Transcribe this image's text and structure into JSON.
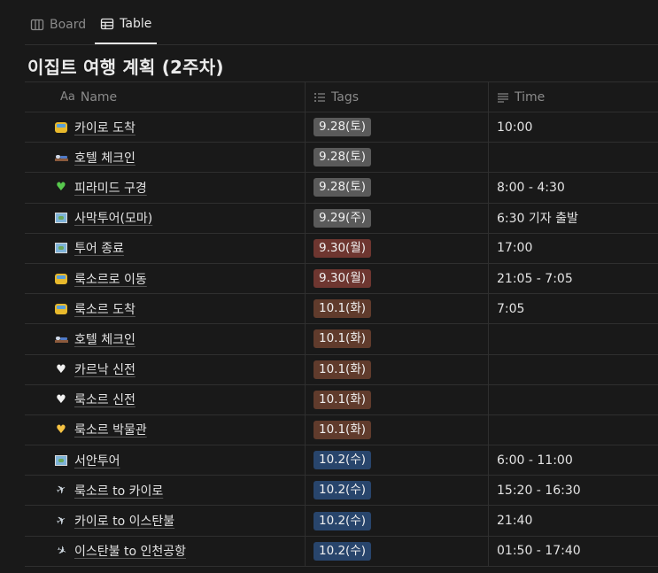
{
  "tabs": [
    {
      "label": "Board",
      "icon": "board-icon",
      "active": false
    },
    {
      "label": "Table",
      "icon": "table-icon",
      "active": true
    }
  ],
  "title": "이집트 여행 계획 (2주차)",
  "columns": {
    "name": {
      "icon_text": "Aa",
      "label": "Name"
    },
    "tags": {
      "icon": "list-icon",
      "label": "Tags"
    },
    "time": {
      "icon": "text-lines-icon",
      "label": "Time"
    }
  },
  "tag_colors": {
    "gray": "#5a5a5a",
    "red": "#6e3630",
    "brown": "#603b2c",
    "blue": "#28456c"
  },
  "rows": [
    {
      "icon": "bus-icon",
      "name": "카이로 도착",
      "tag": "9.28(토)",
      "tag_color": "gray",
      "time": "10:00"
    },
    {
      "icon": "bed-icon",
      "name": "호텔 체크인",
      "tag": "9.28(토)",
      "tag_color": "gray",
      "time": ""
    },
    {
      "icon": "green-heart-icon",
      "name": "피라미드 구경",
      "tag": "9.28(토)",
      "tag_color": "gray",
      "time": "8:00 - 4:30"
    },
    {
      "icon": "map-icon",
      "name": "사막투어(모마)",
      "tag": "9.29(주)",
      "tag_color": "gray",
      "time": "6:30 기자 출발"
    },
    {
      "icon": "map-icon",
      "name": "투어 종료",
      "tag": "9.30(월)",
      "tag_color": "red",
      "time": "17:00"
    },
    {
      "icon": "bus-icon",
      "name": "룩소르로 이동",
      "tag": "9.30(월)",
      "tag_color": "red",
      "time": "21:05 - 7:05"
    },
    {
      "icon": "bus-icon",
      "name": "룩소르 도착",
      "tag": "10.1(화)",
      "tag_color": "brown",
      "time": "7:05"
    },
    {
      "icon": "bed-icon",
      "name": "호텔 체크인",
      "tag": "10.1(화)",
      "tag_color": "brown",
      "time": ""
    },
    {
      "icon": "white-heart-icon",
      "name": "카르낙 신전",
      "tag": "10.1(화)",
      "tag_color": "brown",
      "time": ""
    },
    {
      "icon": "white-heart-icon",
      "name": "룩소르 신전",
      "tag": "10.1(화)",
      "tag_color": "brown",
      "time": ""
    },
    {
      "icon": "yellow-heart-icon",
      "name": "룩소르 박물관",
      "tag": "10.1(화)",
      "tag_color": "brown",
      "time": ""
    },
    {
      "icon": "map-icon",
      "name": "서안투어",
      "tag": "10.2(수)",
      "tag_color": "blue",
      "time": "6:00 - 11:00"
    },
    {
      "icon": "airplane-departure-icon",
      "name": "룩소르 to 카이로",
      "tag": "10.2(수)",
      "tag_color": "blue",
      "time": "15:20 - 16:30"
    },
    {
      "icon": "airplane-departure-icon",
      "name": "카이로 to 이스탄불",
      "tag": "10.2(수)",
      "tag_color": "blue",
      "time": "21:40"
    },
    {
      "icon": "airplane-arrival-icon",
      "name": "이스탄불 to 인천공항",
      "tag": "10.2(수)",
      "tag_color": "blue",
      "time": "01:50 - 17:40"
    }
  ]
}
